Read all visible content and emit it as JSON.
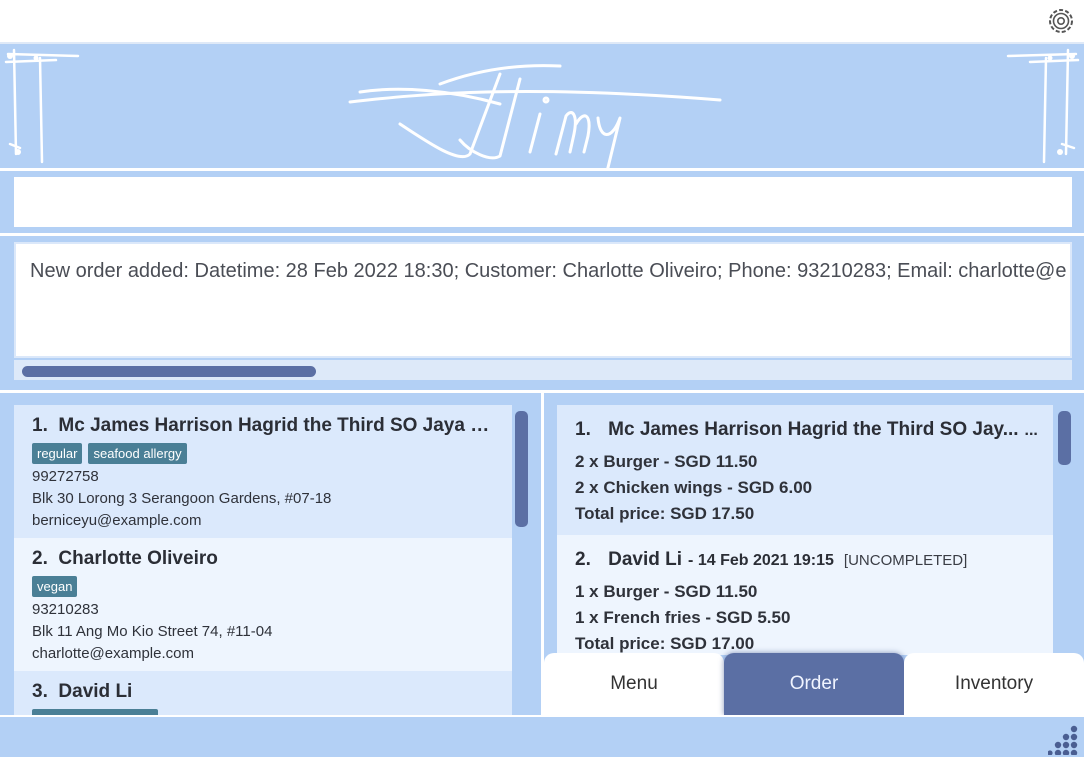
{
  "app": {
    "logo_text": "Jjimy"
  },
  "header": {
    "settings_icon": "gear-icon"
  },
  "command": {
    "value": "",
    "placeholder": ""
  },
  "result": {
    "message": "New order added: Datetime: 28 Feb 2022 18:30; Customer: Charlotte Oliveiro; Phone: 93210283; Email: charlotte@e"
  },
  "customers": [
    {
      "index": "1.",
      "name": "Mc James Harrison Hagrid the Third SO Jaya R...",
      "tags": [
        "regular",
        "seafood allergy"
      ],
      "phone": "99272758",
      "address": "Blk 30 Lorong 3 Serangoon Gardens, #07-18",
      "email": "berniceyu@example.com"
    },
    {
      "index": "2.",
      "name": "Charlotte Oliveiro",
      "tags": [
        "vegan"
      ],
      "phone": "93210283",
      "address": "Blk 11 Ang Mo Kio Street 74, #11-04",
      "email": "charlotte@example.com"
    },
    {
      "index": "3.",
      "name": "David Li",
      "tags": [
        ""
      ],
      "phone": "",
      "address": "",
      "email": ""
    }
  ],
  "orders": [
    {
      "index": "1.",
      "customer": "Mc James Harrison Hagrid the Third SO Jay...",
      "datetime": "...",
      "status": "",
      "items": [
        "2 x Burger - SGD 11.50",
        "2 x Chicken wings - SGD 6.00"
      ],
      "total": "Total price: SGD 17.50"
    },
    {
      "index": "2.",
      "customer": "David Li",
      "datetime": "- 14 Feb 2021 19:15",
      "status": "[UNCOMPLETED]",
      "items": [
        "1 x Burger - SGD 11.50",
        "1 x French fries - SGD 5.50"
      ],
      "total": "Total price: SGD 17.00"
    }
  ],
  "tabs": [
    {
      "label": "Menu",
      "active": false
    },
    {
      "label": "Order",
      "active": true
    },
    {
      "label": "Inventory",
      "active": false
    }
  ],
  "colors": {
    "background": "#b3d0f5",
    "accent": "#5b6fa4",
    "tag": "#4a7f96",
    "card_odd": "#dbe9fc",
    "card_even": "#eef5fe"
  },
  "status_bar": {
    "grip_icon": "resize-grip-icon"
  }
}
